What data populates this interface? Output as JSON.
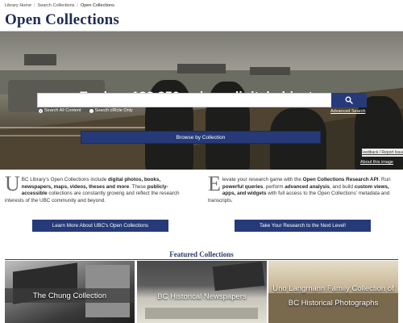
{
  "breadcrumb": {
    "items": [
      "Library Home",
      "Search Collections",
      "Open Collections"
    ]
  },
  "page_title": "Open Collections",
  "hero": {
    "heading": "Explore 183,850 unique digital objects.",
    "search_value": "",
    "radio_all": "Search All Content",
    "radio_cirle": "Search cIRcle Only",
    "radio_selected": "all",
    "advanced_search": "Advanced Search",
    "browse_label": "Browse by Collection",
    "feedback": "Feedback / Report Issue",
    "about_image": "About this image"
  },
  "intro_left": {
    "dropcap": "U",
    "parts": [
      "BC Library's Open Collections include ",
      "digital photos, books, newspapers, maps, videos, theses and more",
      ". These ",
      "publicly-accessible",
      " collections are constantly growing and reflect the research interests of the UBC community and beyond."
    ],
    "button": "Learn More About UBC's Open Collections"
  },
  "intro_right": {
    "dropcap": "E",
    "parts": [
      "levate your research game with the ",
      "Open Collections Research API",
      ". Run ",
      "powerful queries",
      ", perform ",
      "advanced analysis",
      ", and build ",
      "custom views, apps, and widgets",
      " with full access to the Open Collections' metadata and transcripts."
    ],
    "button": "Take Your Research to the Next Level!"
  },
  "featured": {
    "title": "Featured Collections",
    "tiles": [
      {
        "label": "The Chung Collection"
      },
      {
        "label": "BC Historical Newspapers"
      },
      {
        "label_line1": "Uno Langmann Family Collection of",
        "label_line2": "BC Historical Photographs"
      }
    ]
  },
  "colors": {
    "accent": "#263a79",
    "title": "#1f2d52"
  }
}
